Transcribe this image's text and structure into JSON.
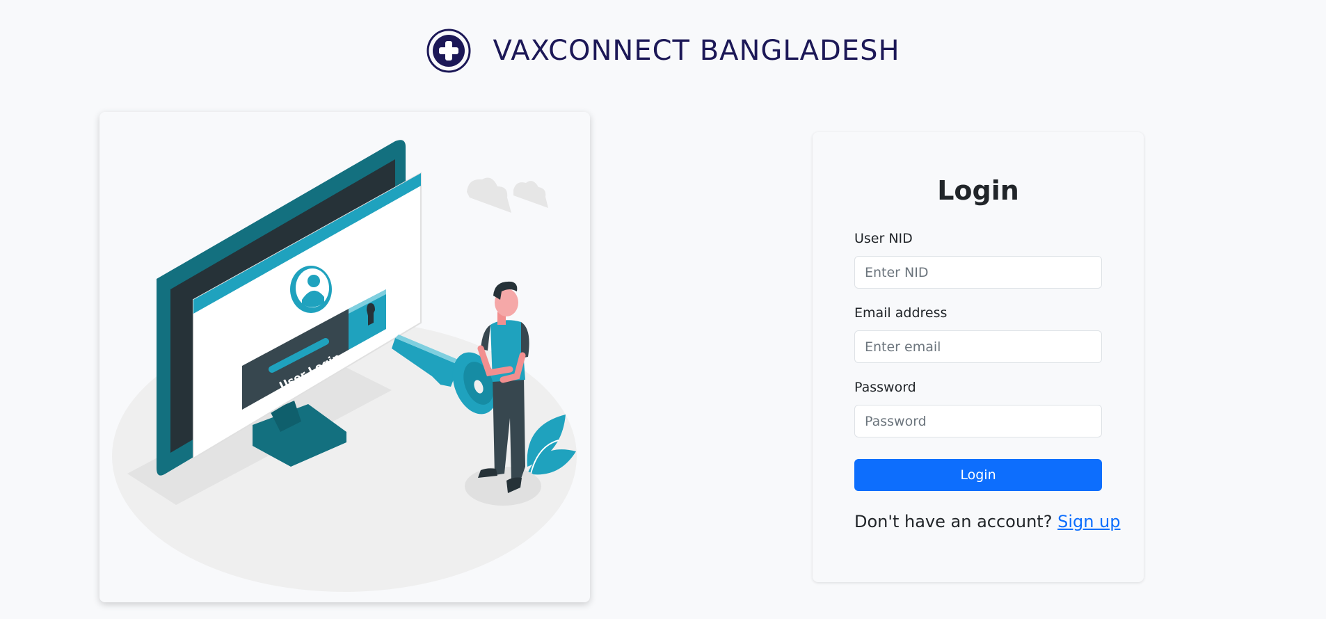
{
  "brand": {
    "name": "VAXCONNECT BANGLADESH",
    "logo_icon": "medical-cross-icon",
    "color": "#1c1857"
  },
  "illustration": {
    "screen_text": "User Login",
    "accent_color": "#1fa2be"
  },
  "login_form": {
    "title": "Login",
    "nid_label": "User NID",
    "nid_placeholder": "Enter NID",
    "email_label": "Email address",
    "email_placeholder": "Enter email",
    "password_label": "Password",
    "password_placeholder": "Password",
    "submit_label": "Login",
    "signup_prompt": "Don't have an account?",
    "signup_link": "Sign up",
    "button_color": "#0d6efd"
  }
}
